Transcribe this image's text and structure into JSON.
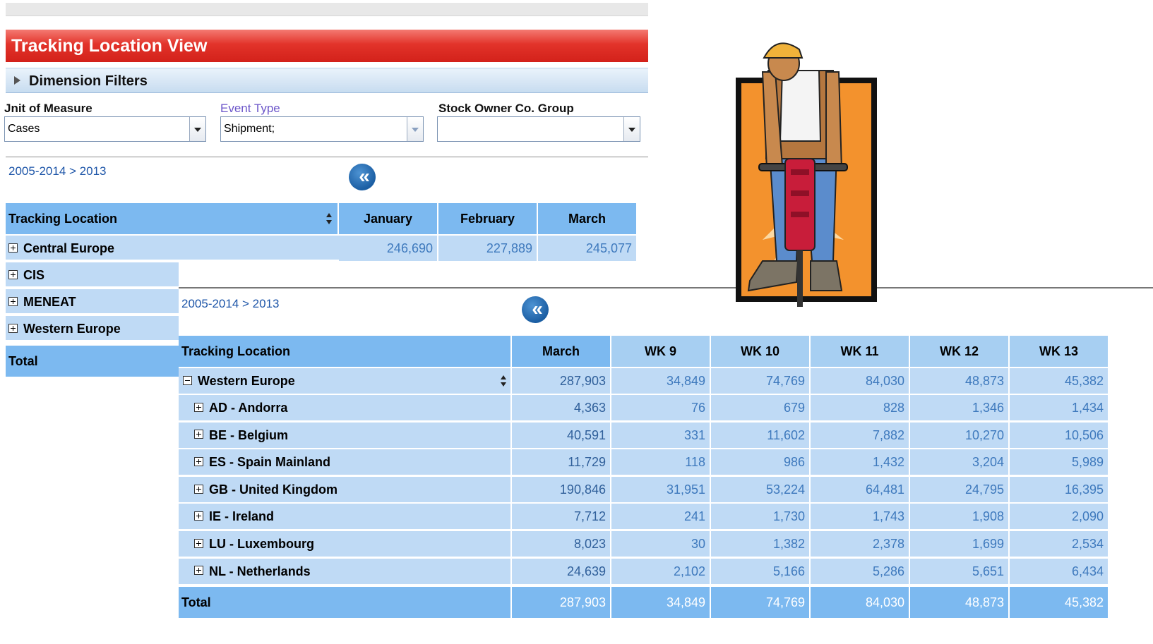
{
  "back": {
    "title": "Tracking Location View",
    "filters_label": "Dimension Filters",
    "filters": [
      {
        "label": "Unit of Measure",
        "display_label": "Jnit of Measure",
        "value": "Cases"
      },
      {
        "label": "Event Type",
        "value": "Shipment;"
      },
      {
        "label": "Stock Owner Co. Group",
        "value": ""
      }
    ],
    "breadcrumb": "2005-2014 > 2013",
    "grid": {
      "row_header": "Tracking Location",
      "columns": [
        "January",
        "February",
        "March"
      ],
      "rows": [
        {
          "label": "Central Europe",
          "values": [
            "246,690",
            "227,889",
            "245,077"
          ]
        },
        {
          "label": "CIS",
          "values": [
            "",
            "",
            ""
          ]
        },
        {
          "label": "MENEAT",
          "values": [
            "",
            "",
            ""
          ]
        },
        {
          "label": "Western Europe",
          "values": [
            "",
            "",
            ""
          ]
        }
      ],
      "total_label": "Total"
    }
  },
  "front": {
    "breadcrumb": "2005-2014 > 2013",
    "grid": {
      "row_header": "Tracking Location",
      "columns": [
        "March",
        "WK 9",
        "WK 10",
        "WK 11",
        "WK 12",
        "WK 13"
      ],
      "group": {
        "label": "Western Europe",
        "values": [
          "287,903",
          "34,849",
          "74,769",
          "84,030",
          "48,873",
          "45,382"
        ]
      },
      "rows": [
        {
          "label": "AD - Andorra",
          "values": [
            "4,363",
            "76",
            "679",
            "828",
            "1,346",
            "1,434"
          ]
        },
        {
          "label": "BE - Belgium",
          "values": [
            "40,591",
            "331",
            "11,602",
            "7,882",
            "10,270",
            "10,506"
          ]
        },
        {
          "label": "ES - Spain Mainland",
          "values": [
            "11,729",
            "118",
            "986",
            "1,432",
            "3,204",
            "5,989"
          ]
        },
        {
          "label": "GB - United Kingdom",
          "values": [
            "190,846",
            "31,951",
            "53,224",
            "64,481",
            "24,795",
            "16,395"
          ]
        },
        {
          "label": "IE - Ireland",
          "values": [
            "7,712",
            "241",
            "1,730",
            "1,743",
            "1,908",
            "2,090"
          ]
        },
        {
          "label": "LU - Luxembourg",
          "values": [
            "8,023",
            "30",
            "1,382",
            "2,378",
            "1,699",
            "2,534"
          ]
        },
        {
          "label": "NL - Netherlands",
          "values": [
            "24,639",
            "2,102",
            "5,166",
            "5,286",
            "5,651",
            "6,434"
          ]
        }
      ],
      "total": {
        "label": "Total",
        "values": [
          "287,903",
          "34,849",
          "74,769",
          "84,030",
          "48,873",
          "45,382"
        ]
      }
    }
  },
  "colors": {
    "title_red": "#d3211a",
    "header_blue": "#7cb9f0",
    "row_blue": "#bfdaf5",
    "value_blue": "#3e79bd",
    "link_blue": "#1d55a8"
  },
  "icons": [
    "triangle-right-icon",
    "chevron-down-icon",
    "collapse-double-chevron-icon",
    "expand-plus-icon",
    "collapse-minus-icon",
    "sort-icon",
    "construction-worker-jackhammer-clipart"
  ]
}
